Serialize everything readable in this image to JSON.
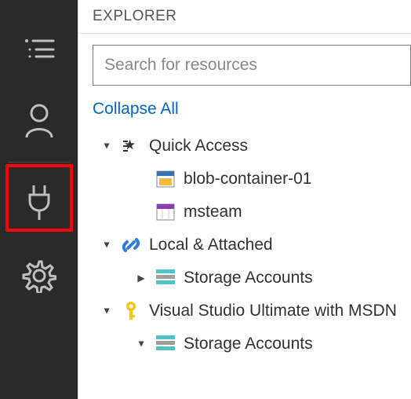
{
  "header": {
    "title": "EXPLORER"
  },
  "search": {
    "placeholder": "Search for resources"
  },
  "actions": {
    "collapse_all": "Collapse All"
  },
  "tree": {
    "quick_access": {
      "label": "Quick Access",
      "children": [
        {
          "id": "blob",
          "label": "blob-container-01"
        },
        {
          "id": "msteam",
          "label": "msteam"
        }
      ]
    },
    "local_attached": {
      "label": "Local & Attached",
      "children": [
        {
          "id": "storage1",
          "label": "Storage Accounts"
        }
      ]
    },
    "subscription": {
      "label": "Visual Studio Ultimate with MSDN",
      "children": [
        {
          "id": "storage2",
          "label": "Storage Accounts"
        }
      ]
    }
  }
}
